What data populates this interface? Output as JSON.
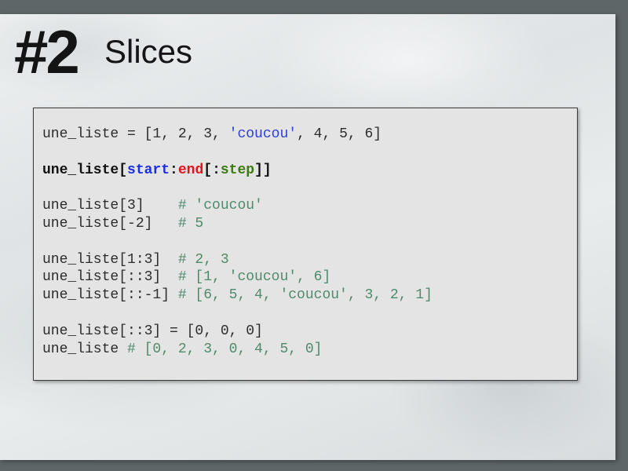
{
  "slide": {
    "number": "#2",
    "title": "Slices"
  },
  "code": {
    "line1": {
      "pre": "une_liste = [1, 2, 3, ",
      "str": "'coucou'",
      "post": ", 4, 5, 6]"
    },
    "syntax": {
      "a": "une_liste[",
      "start": "start",
      "colon1": ":",
      "end": "end",
      "b": "[:",
      "step": "step",
      "c": "]]"
    },
    "idx1": {
      "code": "une_liste[3]    ",
      "comment": "# 'coucou'"
    },
    "idx2": {
      "code": "une_liste[-2]   ",
      "comment": "# 5"
    },
    "sl1": {
      "code": "une_liste[1:3]  ",
      "comment": "# 2, 3"
    },
    "sl2": {
      "code": "une_liste[::3]  ",
      "comment": "# [1, 'coucou', 6]"
    },
    "sl3": {
      "code": "une_liste[::-1] ",
      "comment": "# [6, 5, 4, 'coucou', 3, 2, 1]"
    },
    "as1": {
      "code": "une_liste[::3] = [0, 0, 0]"
    },
    "as2": {
      "code": "une_liste ",
      "comment": "# [0, 2, 3, 0, 4, 5, 0]"
    }
  },
  "colors": {
    "string": "#2a3fd8",
    "comment": "#4f8a6a",
    "start": "#1c2fe0",
    "end": "#e0141a",
    "step": "#3c7a14"
  }
}
